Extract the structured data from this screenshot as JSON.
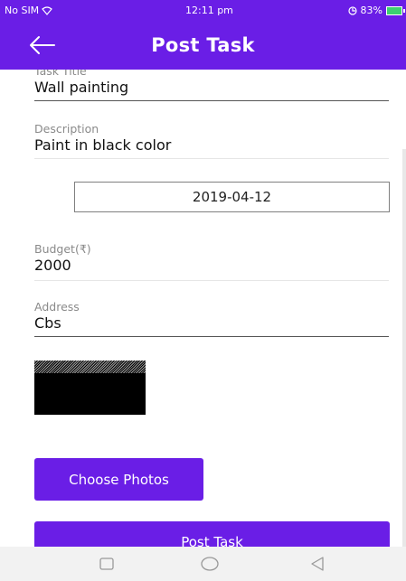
{
  "status_bar": {
    "carrier": "No SIM",
    "time": "12:11 pm",
    "battery": "83%"
  },
  "header": {
    "title": "Post Task"
  },
  "form": {
    "task_title": {
      "label": "Task Title",
      "value": "Wall painting"
    },
    "description": {
      "label": "Description",
      "value": "Paint in black color"
    },
    "date": "2019-04-12",
    "budget": {
      "label": "Budget(₹)",
      "value": "2000"
    },
    "address": {
      "label": "Address",
      "value": "Cbs"
    }
  },
  "buttons": {
    "choose_photos": "Choose Photos",
    "post_task": "Post Task"
  },
  "colors": {
    "primary": "#6a1ee6",
    "nav_bar": "#f2f2f2"
  },
  "icons": {
    "back": "arrow-left-icon",
    "wifi": "wifi-icon",
    "battery": "battery-icon",
    "nav_square": "recent-apps-icon",
    "nav_circle": "home-icon",
    "nav_triangle": "back-nav-icon"
  }
}
